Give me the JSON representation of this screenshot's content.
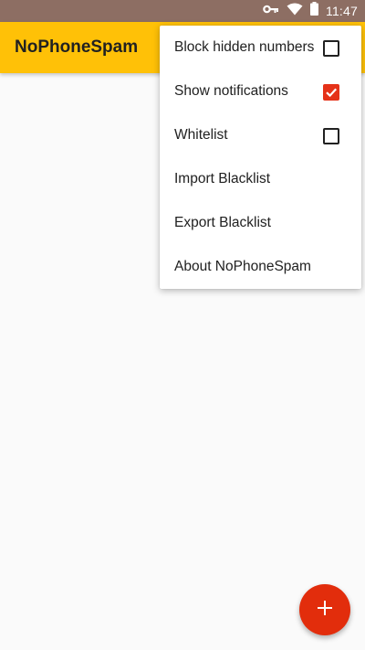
{
  "status_bar": {
    "time": "11:47",
    "icons": [
      "vpn-key-icon",
      "wifi-icon",
      "battery-icon"
    ]
  },
  "app_bar": {
    "title": "NoPhoneSpam",
    "color": "#ffc107"
  },
  "menu": {
    "items": [
      {
        "label": "Block hidden numbers",
        "checkbox": true,
        "checked": false
      },
      {
        "label": "Show notifications",
        "checkbox": true,
        "checked": true
      },
      {
        "label": "Whitelist",
        "checkbox": true,
        "checked": false
      },
      {
        "label": "Import Blacklist",
        "checkbox": false
      },
      {
        "label": "Export Blacklist",
        "checkbox": false
      },
      {
        "label": "About NoPhoneSpam",
        "checkbox": false
      }
    ]
  },
  "fab": {
    "icon": "plus-icon",
    "color": "#e22d0c"
  },
  "colors": {
    "status_bar": "#8d6e63",
    "accent": "#e53219",
    "background": "#fafafa"
  }
}
